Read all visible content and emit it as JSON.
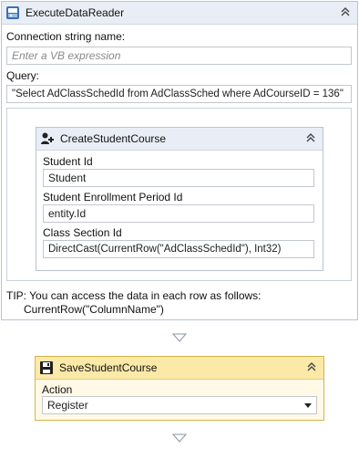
{
  "execute": {
    "title": "ExecuteDataReader",
    "connection_label": "Connection string name:",
    "connection_placeholder": "Enter a VB expression",
    "query_label": "Query:",
    "query_value": "\"Select AdClassSchedId from AdClassSched where AdCourseID = 136\"",
    "tip_line1": "TIP: You can access the data in each row as follows:",
    "tip_line2": "CurrentRow(\"ColumnName\")"
  },
  "create": {
    "title": "CreateStudentCourse",
    "student_id_label": "Student Id",
    "student_id_value": "Student",
    "enrollment_label": "Student Enrollment Period Id",
    "enrollment_value": "entity.Id",
    "class_section_label": "Class Section Id",
    "class_section_value": "DirectCast(CurrentRow(\"AdClassSchedId\"), Int32)"
  },
  "save": {
    "title": "SaveStudentCourse",
    "action_label": "Action",
    "action_value": "Register"
  },
  "colors": {
    "header_blue": "#e9eef6",
    "header_yellow": "#fbe9a8",
    "border": "#b9c4d3"
  },
  "icons": {
    "execute": "database-reader-icon",
    "create": "person-add-icon",
    "save": "floppy-disk-icon",
    "collapse": "double-chevron-up-icon",
    "connector": "triangle-down-icon",
    "dropdown": "caret-down-icon"
  }
}
